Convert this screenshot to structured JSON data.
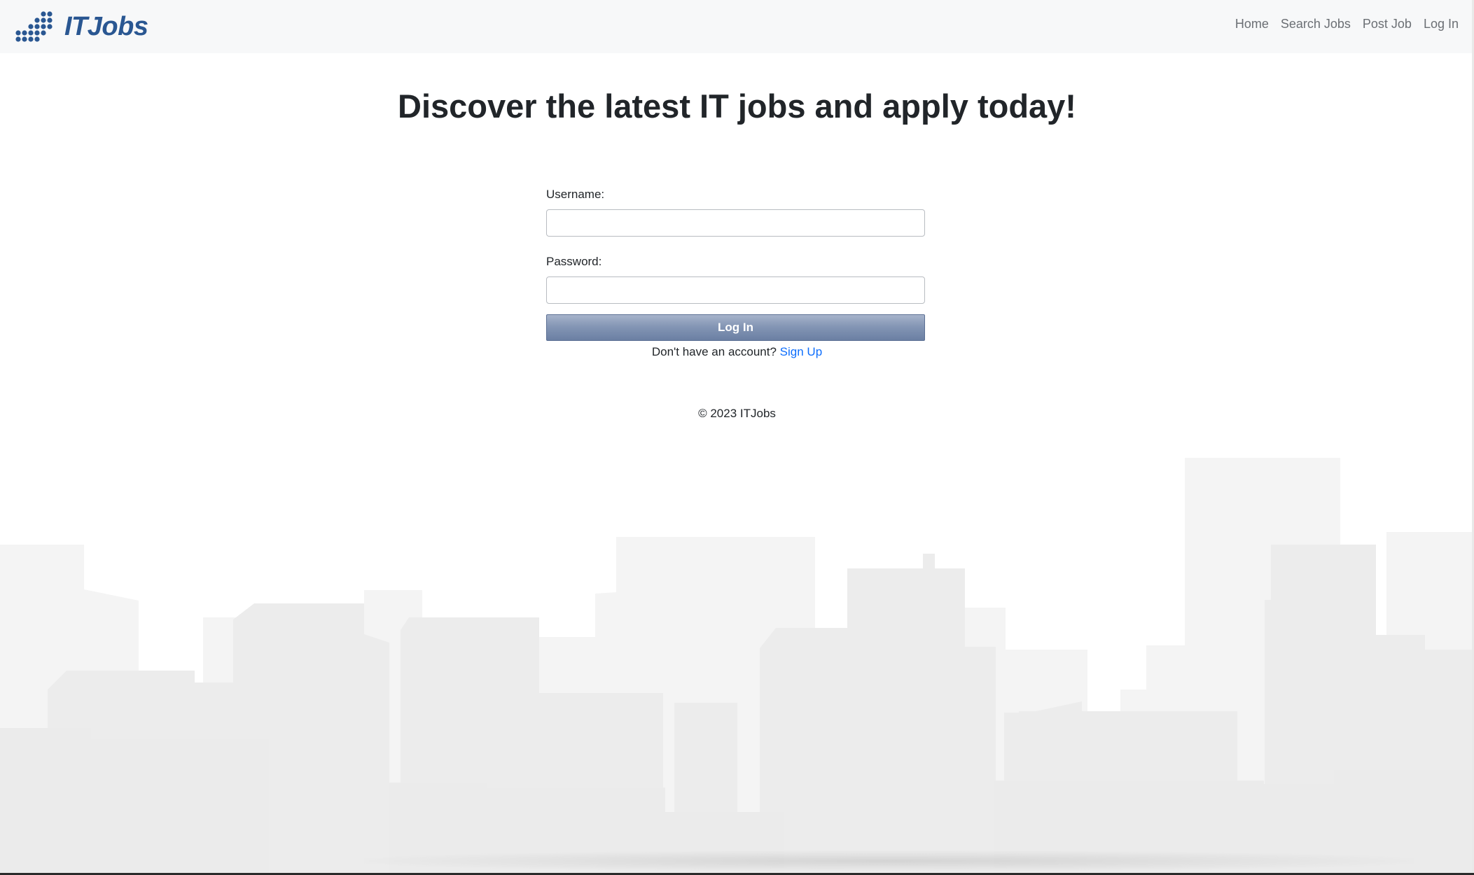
{
  "header": {
    "brand": "ITJobs",
    "nav": [
      {
        "label": "Home"
      },
      {
        "label": "Search Jobs"
      },
      {
        "label": "Post Job"
      },
      {
        "label": "Log In"
      }
    ]
  },
  "main": {
    "headline": "Discover the latest IT jobs and apply today!",
    "form": {
      "username_label": "Username:",
      "username_value": "",
      "password_label": "Password:",
      "password_value": "",
      "submit_label": "Log In"
    },
    "signup": {
      "prompt": "Don't have an account?",
      "link": "Sign Up"
    }
  },
  "footer": {
    "text": "© 2023 ITJobs"
  },
  "colors": {
    "brand": "#2a5792",
    "link": "#0d6efd",
    "button": "#8496b5",
    "navbar_bg": "#f7f8f9",
    "skyline": "#ececec"
  }
}
